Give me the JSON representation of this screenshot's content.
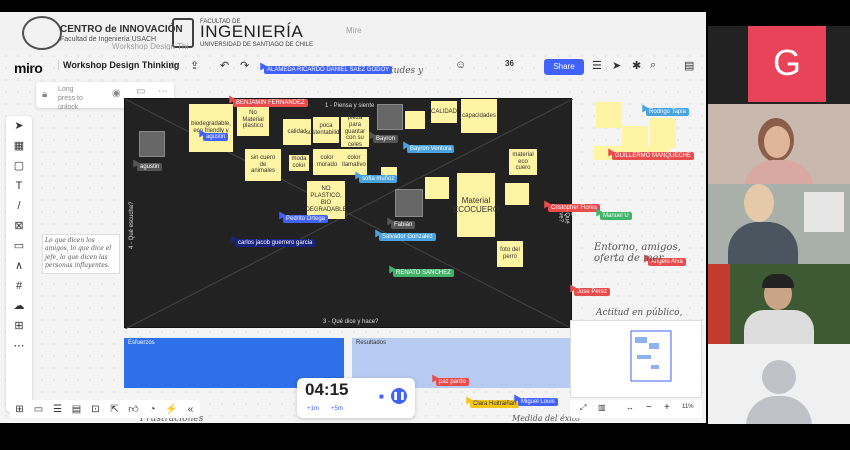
{
  "banner": {
    "centro": "CENTRO de INNOVACIÓN",
    "centro_sub": "Facultad de Ingeniería USACH",
    "facultad": "FACULTAD DE",
    "ingenieria": "INGENIERÍA",
    "univ": "UNIVERSIDAD DE SANTIAGO DE CHILE"
  },
  "miro": {
    "logo": "miro",
    "title": "Workshop Design Thinking",
    "lock_label": "Long press to unlock",
    "share": "Share",
    "avatar_count": "36",
    "timer": "04:15",
    "timer_plus1": "+1m",
    "timer_plus5": "+5m",
    "zoom": "11%"
  },
  "frame": {
    "top_label": "1 - Piensa y siente",
    "left_label": "4 - Qué escucha?",
    "bottom_label": "3 - Qué dice y hace?",
    "right_label": "2 - Qué ve?"
  },
  "stickies": [
    {
      "t": "biodegradable, eco friendly y"
    },
    {
      "t": "No Material plastico"
    },
    {
      "t": "calidad"
    },
    {
      "t": "poca sustentabilidad"
    },
    {
      "t": "pieza para guantar con su celes"
    },
    {
      "t": "CALIDAD"
    },
    {
      "t": "capacidades"
    },
    {
      "t": "sin cuero de animales"
    },
    {
      "t": "moda color"
    },
    {
      "t": "color morado"
    },
    {
      "t": "color llamativo"
    },
    {
      "t": "material eco cuero"
    },
    {
      "t": "NO PLASTICO, BIO DEGRADABLE"
    },
    {
      "t": "Material ECOCUERO"
    },
    {
      "t": "foto del perro"
    }
  ],
  "cursors": [
    {
      "n": "ALAMEDA RICARDO DANIEL SAEZ GODOY",
      "c": "#4262ff"
    },
    {
      "n": "BENJAMIN FERNANDEZ",
      "c": "#e94c4c"
    },
    {
      "n": "agustin",
      "c": "#4262ff"
    },
    {
      "n": "agustin",
      "c": "#555555"
    },
    {
      "n": "Bayron",
      "c": "#555555"
    },
    {
      "n": "Bayron Ventura",
      "c": "#4aa3df"
    },
    {
      "n": "sofia muñoz",
      "c": "#4aa3df"
    },
    {
      "n": "Pedrito Ortega",
      "c": "#4262ff"
    },
    {
      "n": "Fabián",
      "c": "#555555"
    },
    {
      "n": "Salvador Gonzalez",
      "c": "#4aa3df"
    },
    {
      "n": "carlos jacob guerrero garcia",
      "c": "#1a237e"
    },
    {
      "n": "RENATO SANCHEZ",
      "c": "#43b36a"
    },
    {
      "n": "Rodrigo Tapia",
      "c": "#4aa3df"
    },
    {
      "n": "GUILLERMO MANQUECHE",
      "c": "#e94c4c"
    },
    {
      "n": "Cristopher Flores",
      "c": "#e94c4c"
    },
    {
      "n": "Manuel U",
      "c": "#43b36a"
    },
    {
      "n": "Angelo Alva",
      "c": "#e94c4c"
    },
    {
      "n": "Jose Perez",
      "c": "#e94c4c"
    },
    {
      "n": "paz pardo",
      "c": "#e94c4c"
    },
    {
      "n": "Clara Huitraiñan",
      "c": "#f5c518"
    },
    {
      "n": "Miguel Louis",
      "c": "#4262ff"
    }
  ],
  "notes": {
    "left_note": "Lo que dicen los amigos, lo que dice el jefe, lo que dicen las personas influyentes.",
    "right_note1": "Entorno, amigos, oferta de mer",
    "right_note2": "Actitud en público,",
    "actitudes": "Actitudes y",
    "esfuerzos": "Esfuerzos",
    "resultados": "Resultados",
    "frustraciones": "Frustraciones",
    "bottom_right": "Medida del éxito",
    "frustr2": "Frustraciones"
  },
  "faded": {
    "a": "Workshop Design Thi",
    "b": "Miro",
    "c": "Mire"
  },
  "tiles": {
    "g": "G"
  }
}
